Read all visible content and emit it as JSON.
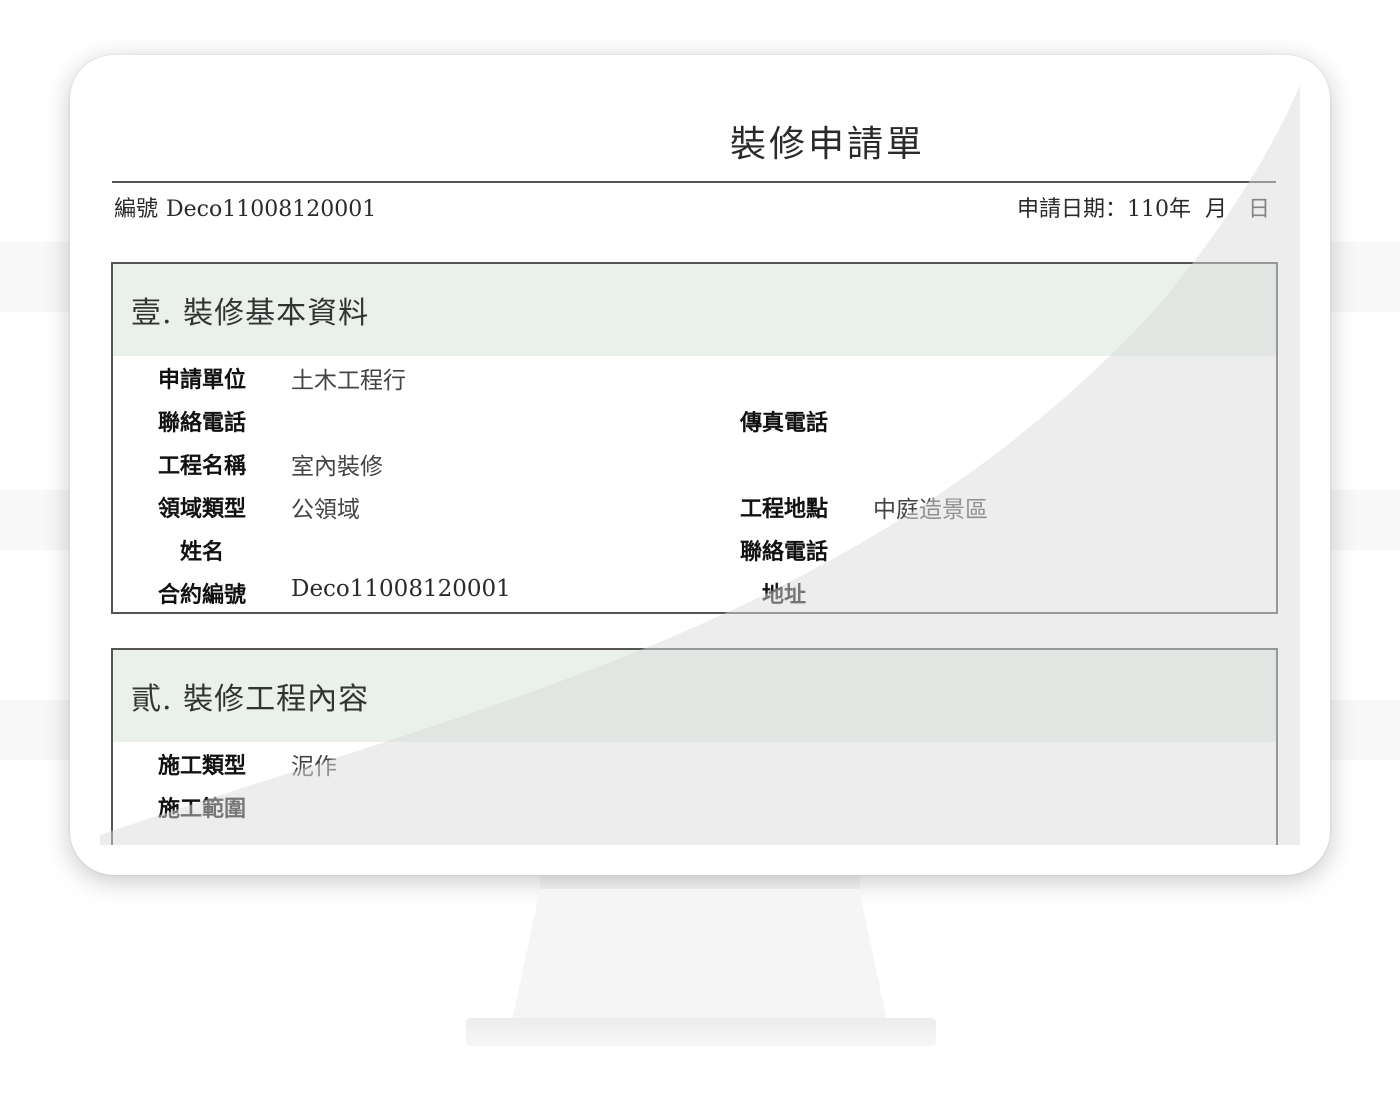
{
  "document": {
    "title": "裝修申請單",
    "number_label": "編號",
    "number_value": "Deco11008120001",
    "apply_date": "申請日期：110年  月   日"
  },
  "section1": {
    "heading": "壹.  裝修基本資料",
    "rows": [
      {
        "label_left": "申請單位",
        "value_left": "土木工程行",
        "label_right": "",
        "value_right": ""
      },
      {
        "label_left": "聯絡電話",
        "value_left": "",
        "label_right": "傳真電話",
        "value_right": ""
      },
      {
        "label_left": "工程名稱",
        "value_left": "室內裝修",
        "label_right": "",
        "value_right": ""
      },
      {
        "label_left": "領域類型",
        "value_left": "公領域",
        "label_right": "工程地點",
        "value_right": "中庭造景區"
      },
      {
        "label_left": "姓名",
        "value_left": "",
        "label_right": "聯絡電話",
        "value_right": ""
      },
      {
        "label_left": "合約編號",
        "value_left": "Deco11008120001",
        "label_right": "地址",
        "value_right": ""
      }
    ]
  },
  "section2": {
    "heading": "貳.  裝修工程內容",
    "rows": [
      {
        "label_left": "施工類型",
        "value_left": "泥作"
      },
      {
        "label_left": "施工範圍",
        "value_left": ""
      }
    ]
  },
  "colors": {
    "section_header_bg": "#e9f1ea",
    "border": "#555555",
    "glare": "#eaeaea"
  }
}
